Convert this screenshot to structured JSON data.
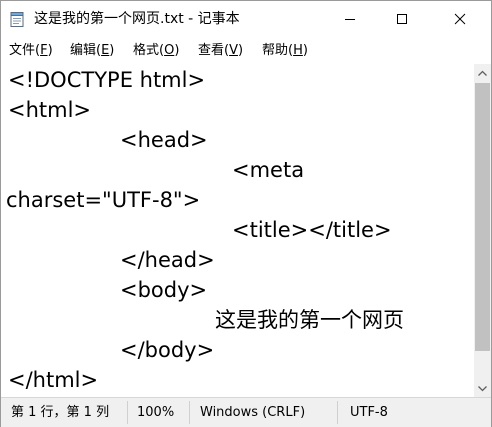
{
  "window": {
    "title": "这是我的第一个网页.txt - 记事本"
  },
  "icons": {
    "app": "notepad-icon",
    "minimize": "minimize-icon",
    "maximize": "maximize-icon",
    "close": "close-icon"
  },
  "menu": {
    "items": [
      {
        "label": "文件(",
        "key": "F",
        "end": ")"
      },
      {
        "label": "编辑(",
        "key": "E",
        "end": ")"
      },
      {
        "label": "格式(",
        "key": "O",
        "end": ")"
      },
      {
        "label": "查看(",
        "key": "V",
        "end": ")"
      },
      {
        "label": "帮助(",
        "key": "H",
        "end": ")"
      }
    ]
  },
  "editor": {
    "lines": [
      "<!DOCTYPE html>",
      "<html>",
      "<head>",
      "<meta",
      "charset=\"UTF-8\">",
      "<title></title>",
      "</head>",
      "<body>",
      "这是我的第一个网页",
      "</body>",
      "</html>"
    ]
  },
  "status": {
    "position": "第 1 行，第 1 列",
    "zoom": "100%",
    "line_ending": "Windows (CRLF)",
    "encoding": "UTF-8"
  },
  "colors": {
    "scrollbar_thumb": "#c1c1c1",
    "statusbar_bg": "#f0f0f0"
  }
}
